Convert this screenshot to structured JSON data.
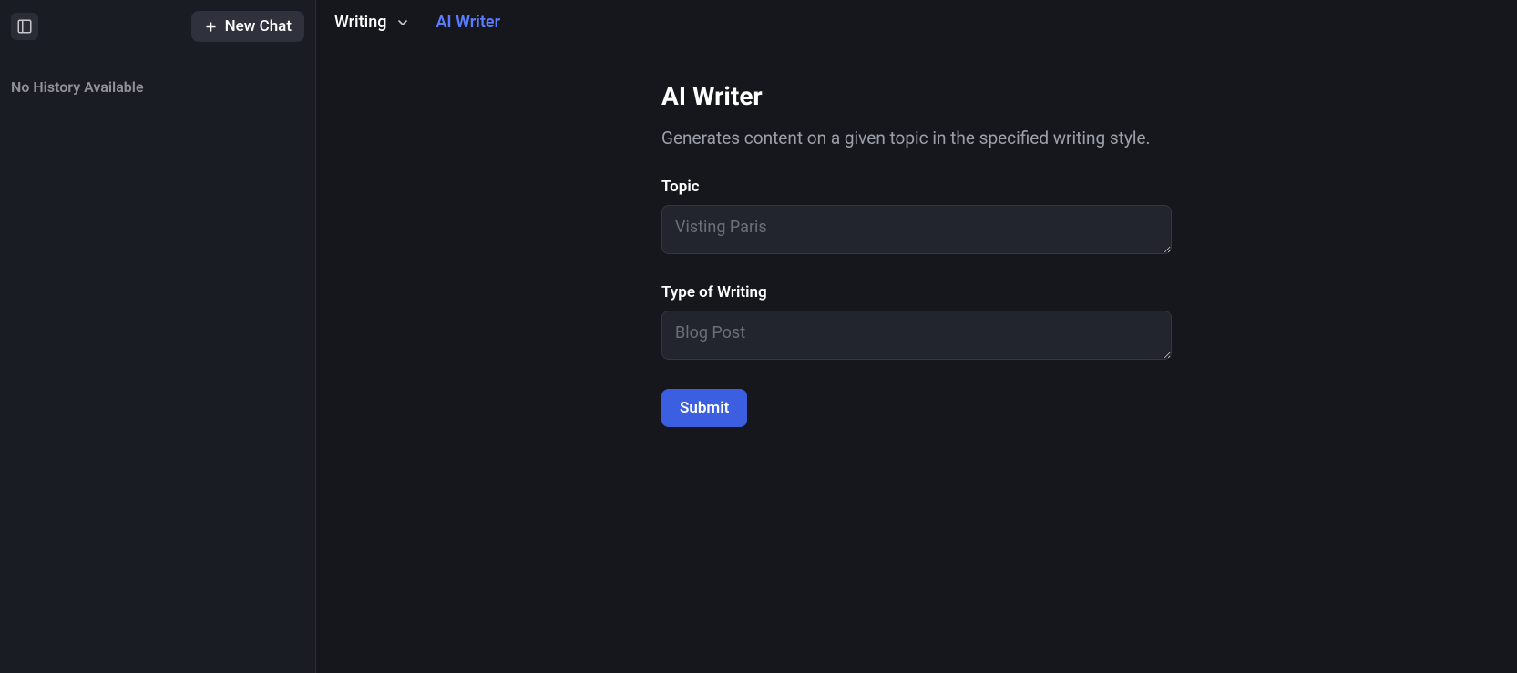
{
  "sidebar": {
    "new_chat_label": "New Chat",
    "empty_message": "No History Available"
  },
  "topbar": {
    "category_label": "Writing",
    "active_tool": "AI Writer"
  },
  "main": {
    "title": "AI Writer",
    "description": "Generates content on a given topic in the specified writing style.",
    "fields": {
      "topic": {
        "label": "Topic",
        "placeholder": "Visting Paris"
      },
      "writing_type": {
        "label": "Type of Writing",
        "placeholder": "Blog Post"
      }
    },
    "submit_label": "Submit"
  }
}
